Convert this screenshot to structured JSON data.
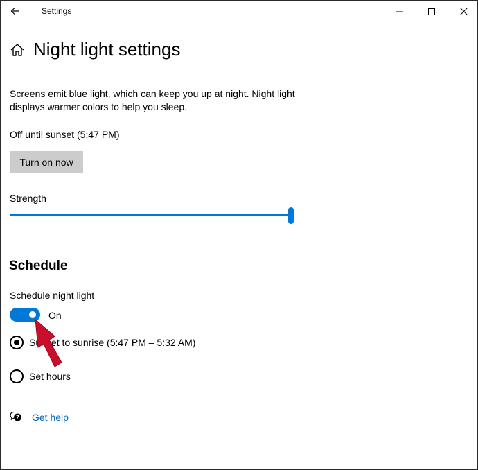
{
  "window": {
    "title": "Settings",
    "controls": [
      "minimize-icon",
      "maximize-icon",
      "close-icon"
    ]
  },
  "header": {
    "title": "Night light settings",
    "icon": "home-icon"
  },
  "description": "Screens emit blue light, which can keep you up at night. Night light displays warmer colors to help you sleep.",
  "status": "Off until sunset (5:47 PM)",
  "turn_on_button": "Turn on now",
  "strength": {
    "label": "Strength",
    "value_fraction": 1.0
  },
  "schedule": {
    "section_title": "Schedule",
    "toggle_label": "Schedule night light",
    "toggle_state": "On",
    "options": [
      {
        "label": "Sunset to sunrise (5:47 PM – 5:32 AM)",
        "selected": true
      },
      {
        "label": "Set hours",
        "selected": false
      }
    ]
  },
  "help": {
    "label": "Get help",
    "icon": "help-chat-icon"
  },
  "annotation": {
    "icon": "red-arrow-icon",
    "color": "#c8102e"
  },
  "colors": {
    "accent": "#0078d7",
    "link": "#0067c0",
    "button_bg": "#cccccc"
  }
}
